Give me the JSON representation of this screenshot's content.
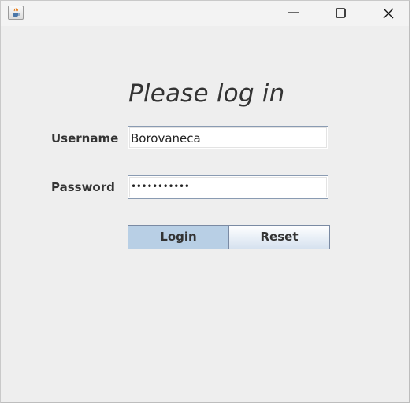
{
  "window": {
    "title": "",
    "app_icon": "java-cup-icon",
    "controls": [
      "minimize-icon",
      "maximize-icon",
      "close-icon"
    ]
  },
  "form": {
    "heading": "Please log in",
    "username_label": "Username",
    "username_value": "Borovaneca",
    "password_label": "Password",
    "password_masked": "•••••••••••",
    "login_label": "Login",
    "reset_label": "Reset"
  },
  "colors": {
    "background": "#eeeeee",
    "login_button": "#b8cfe5",
    "field_border": "#8a9bb2",
    "text": "#333333"
  }
}
